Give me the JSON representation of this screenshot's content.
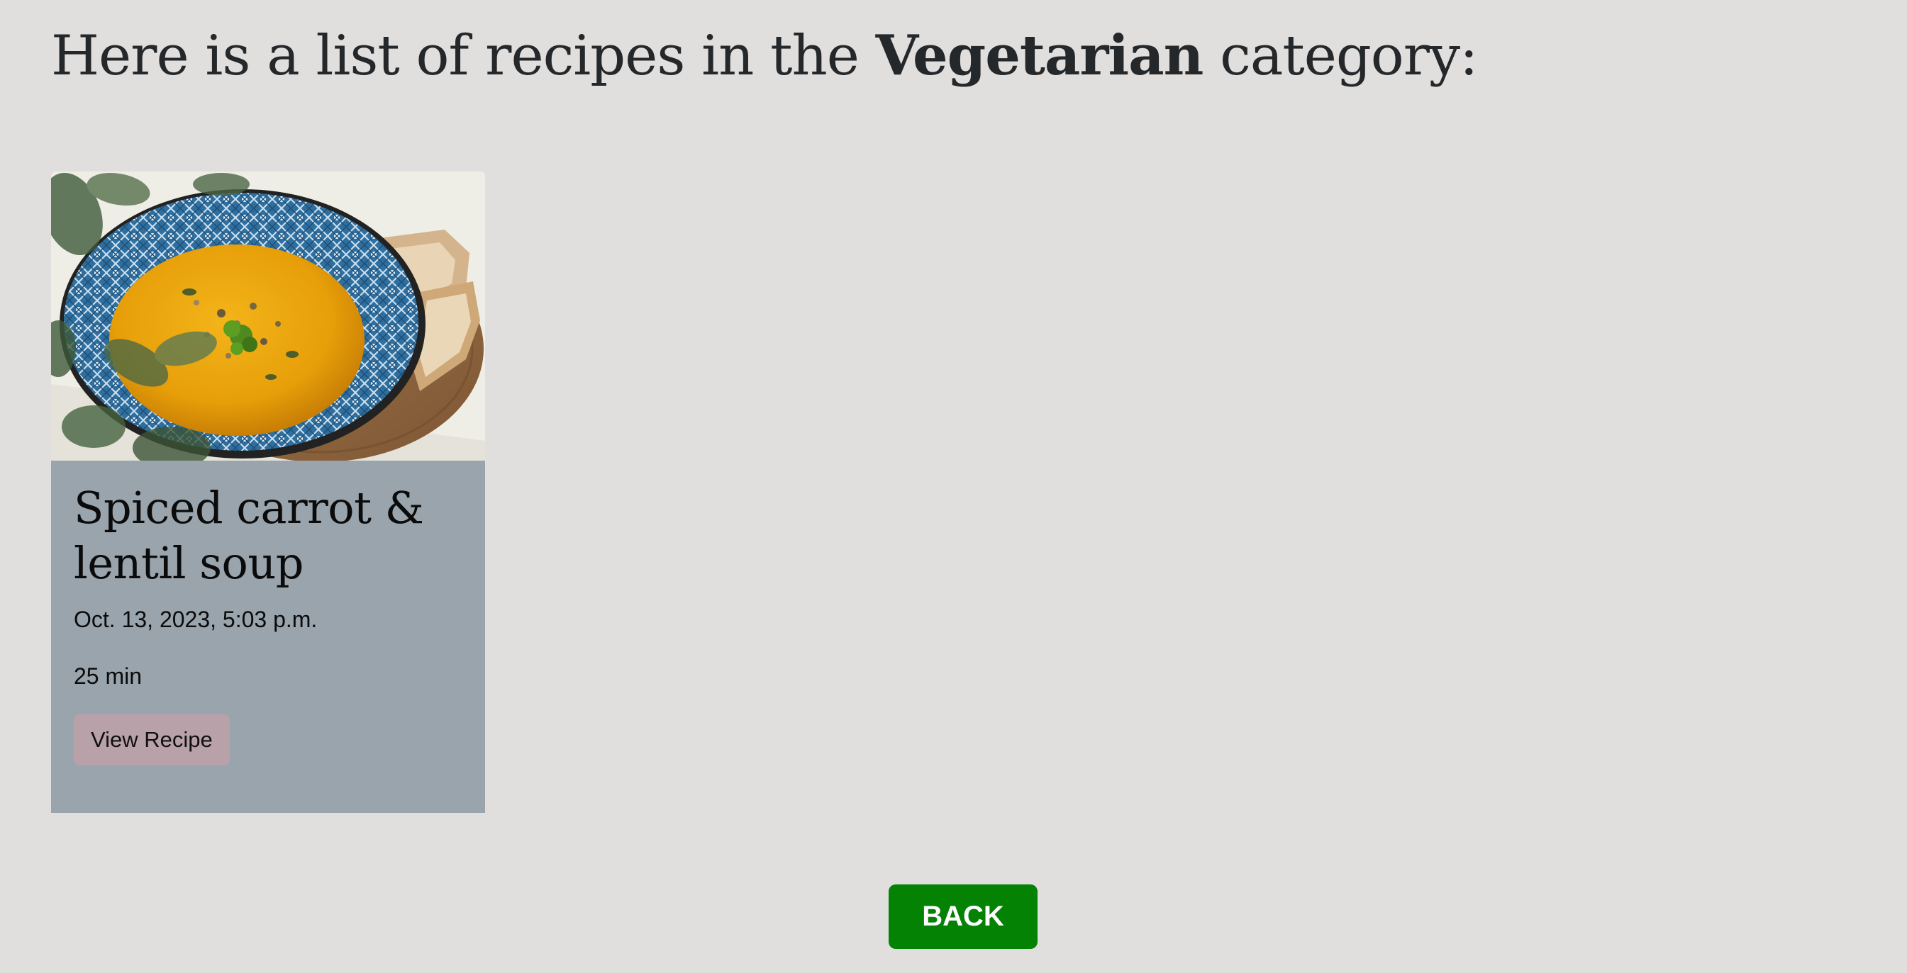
{
  "heading": {
    "prefix": "Here is a list of recipes in the ",
    "category": "Vegetarian",
    "suffix": " category:"
  },
  "recipes": [
    {
      "title": "Spiced carrot & lentil soup",
      "date": "Oct. 13, 2023, 5:03 p.m.",
      "time": "25 min",
      "button_label": "View Recipe",
      "image_icon": "soup-bowl-photo"
    }
  ],
  "back_button": {
    "label": "BACK"
  },
  "colors": {
    "page_background": "#e1dfde",
    "card_background": "#99a4ad",
    "view_button": "#b9a1aa",
    "back_button": "#048204"
  }
}
